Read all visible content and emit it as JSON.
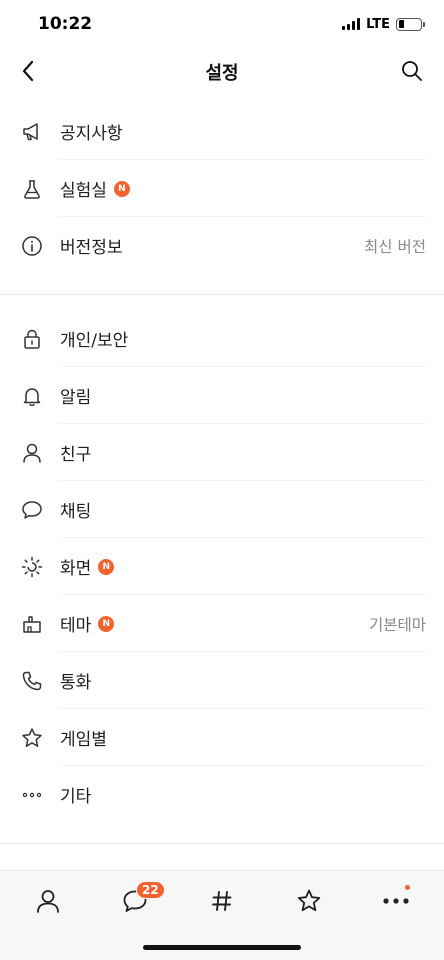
{
  "status_bar": {
    "time": "10:22",
    "network": "LTE"
  },
  "header": {
    "title": "설정"
  },
  "menu": [
    {
      "id": "notice",
      "icon": "megaphone-icon",
      "label": "공지사항",
      "badge": "",
      "value": ""
    },
    {
      "id": "lab",
      "icon": "flask-icon",
      "label": "실험실",
      "badge": "N",
      "value": ""
    },
    {
      "id": "version",
      "icon": "info-icon",
      "label": "버전정보",
      "badge": "",
      "value": "최신 버전"
    },
    {
      "id": "privacy",
      "icon": "lock-icon",
      "label": "개인/보안",
      "badge": "",
      "value": ""
    },
    {
      "id": "alarm",
      "icon": "bell-icon",
      "label": "알림",
      "badge": "",
      "value": ""
    },
    {
      "id": "friends",
      "icon": "person-icon",
      "label": "친구",
      "badge": "",
      "value": ""
    },
    {
      "id": "chat",
      "icon": "speech-bubble-icon",
      "label": "채팅",
      "badge": "",
      "value": ""
    },
    {
      "id": "display",
      "icon": "brightness-icon",
      "label": "화면",
      "badge": "N",
      "value": ""
    },
    {
      "id": "theme",
      "icon": "paint-roller-icon",
      "label": "테마",
      "badge": "N",
      "value": "기본테마"
    },
    {
      "id": "call",
      "icon": "phone-icon",
      "label": "통화",
      "badge": "",
      "value": ""
    },
    {
      "id": "game",
      "icon": "star-icon",
      "label": "게임별",
      "badge": "",
      "value": ""
    },
    {
      "id": "etc",
      "icon": "more-dots-icon",
      "label": "기타",
      "badge": "",
      "value": ""
    }
  ],
  "tab_bar": {
    "tabs": [
      {
        "id": "friends",
        "icon": "person-icon"
      },
      {
        "id": "chats",
        "icon": "speech-bubble-icon",
        "badge": "22"
      },
      {
        "id": "openchat",
        "icon": "hashtag-icon"
      },
      {
        "id": "shopping",
        "icon": "star-icon"
      },
      {
        "id": "more",
        "icon": "more-dots-icon"
      }
    ]
  },
  "colors": {
    "accent": "#f2622e",
    "text": "#1e1e1e",
    "secondary_text": "#8a8a8a",
    "tab_bar_bg": "#f7f7f7"
  }
}
